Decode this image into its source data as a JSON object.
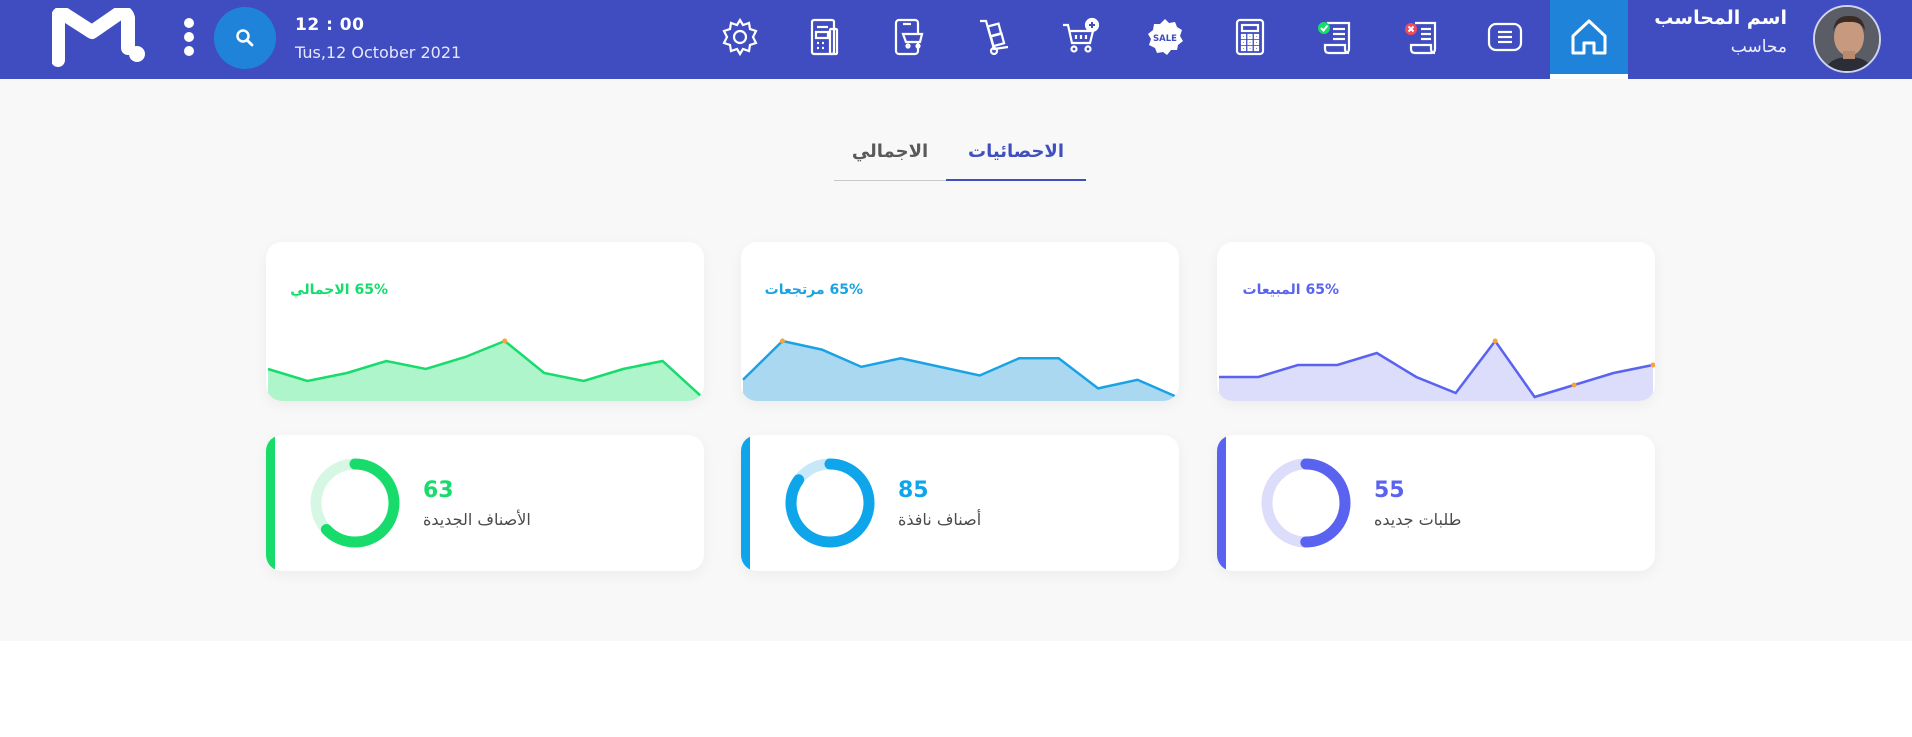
{
  "header": {
    "time": "12 : 00",
    "date": "Tus,12 October 2021",
    "user_name": "اسم المحاسب",
    "user_role": "محاسب",
    "icons": [
      "settings-icon",
      "invoice-icon",
      "mobile-cart-icon",
      "hand-truck-icon",
      "cart-add-icon",
      "sale-badge-icon",
      "calculator-icon",
      "receipt-check-icon",
      "receipt-cancel-icon",
      "menu-list-icon",
      "home-icon"
    ]
  },
  "tabs": {
    "active": "الاحصائيات",
    "inactive": "الاجمالي"
  },
  "cards": [
    {
      "label": "65% المبيعات",
      "color": "#5a63f0",
      "fill": "#dcdcfb",
      "values": [
        5,
        5,
        8,
        8,
        11,
        5,
        1,
        14,
        0,
        3,
        6,
        8
      ],
      "highlight": [
        7,
        9,
        11
      ]
    },
    {
      "label": "65% مرتجعات",
      "color": "#1aa3e4",
      "fill": "#a9d8f0",
      "values": [
        4,
        13,
        11,
        7,
        9,
        7,
        5,
        9,
        9,
        2,
        4,
        0
      ],
      "highlight": [
        1
      ]
    },
    {
      "label": "65% الاجمالي",
      "color": "#17dc6b",
      "fill": "#aef5cc",
      "values": [
        7,
        4,
        6,
        9,
        7,
        10,
        14,
        6,
        4,
        7,
        9,
        0
      ],
      "highlight": [
        6
      ]
    }
  ],
  "stats": [
    {
      "number": "55",
      "label": "طلبات جديده",
      "color": "#5a63f0",
      "track": "#dcdcfb",
      "progress": 0.5
    },
    {
      "number": "85",
      "label": "أصناف نافذة",
      "color": "#0ea5eb",
      "track": "#c6e8f8",
      "progress": 0.85
    },
    {
      "number": "63",
      "label": "الأصناف الجديدة",
      "color": "#17dc6b",
      "track": "#d6f7e4",
      "progress": 0.63
    }
  ]
}
